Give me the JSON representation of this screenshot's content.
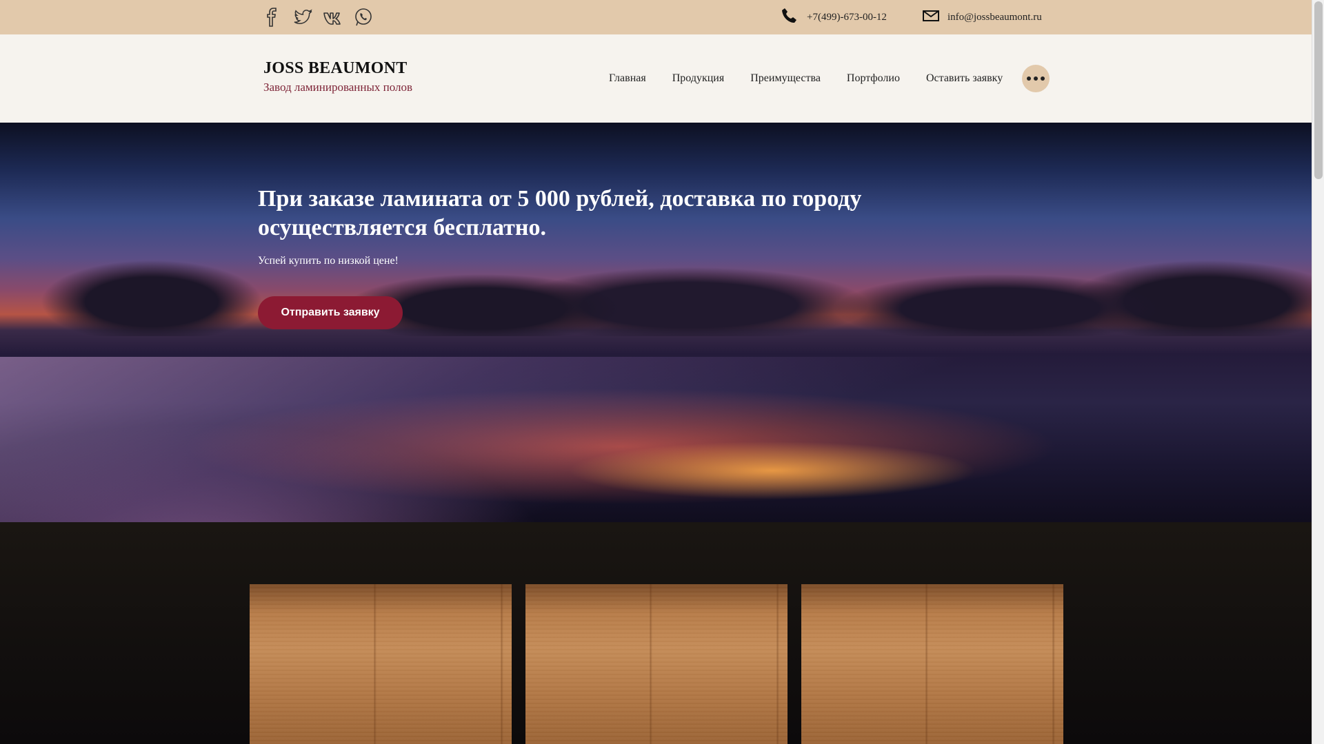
{
  "topbar": {
    "social_icons": [
      "facebook-icon",
      "twitter-icon",
      "vk-icon",
      "whatsapp-icon"
    ],
    "phone": "+7(499)-673-00-12",
    "email": "info@jossbeaumont.ru"
  },
  "header": {
    "brand_name": "JOSS BEAUMONT",
    "brand_subtitle": "Завод ламинированных полов",
    "nav": [
      "Главная",
      "Продукция",
      "Преимущества",
      "Портфолио",
      "Оставить заявку"
    ],
    "more_icon": "more-dots-icon"
  },
  "hero": {
    "title": "При заказе ламината от 5 000 рублей, доставка по городу осуществляется бесплатно.",
    "subtitle": "Успей купить по низкой цене!",
    "button": "Отправить заявку"
  },
  "colors": {
    "topbar_bg": "#e2c9ab",
    "header_bg": "#f6f3ee",
    "accent": "#8c1a33",
    "brand_sub": "#7e2538"
  }
}
